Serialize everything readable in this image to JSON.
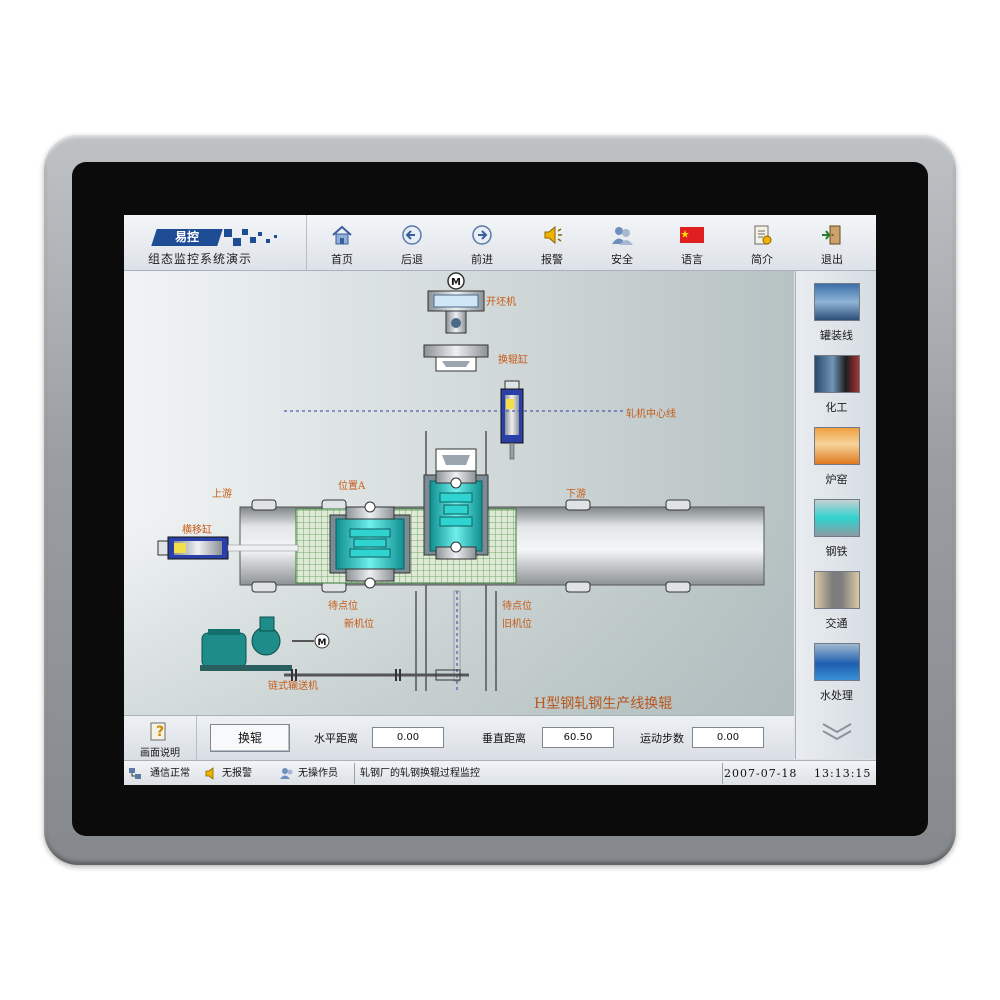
{
  "header": {
    "logo_text": "易控",
    "subtitle": "组态监控系统演示"
  },
  "nav": [
    {
      "label": "首页",
      "icon": "home-icon"
    },
    {
      "label": "后退",
      "icon": "back-arrow-icon"
    },
    {
      "label": "前进",
      "icon": "forward-arrow-icon"
    },
    {
      "label": "报警",
      "icon": "alarm-bell-icon"
    },
    {
      "label": "安全",
      "icon": "security-users-icon"
    },
    {
      "label": "语言",
      "icon": "china-flag-icon"
    },
    {
      "label": "简介",
      "icon": "introduction-document-icon"
    },
    {
      "label": "退出",
      "icon": "exit-door-icon"
    }
  ],
  "sidebar": [
    {
      "label": "罐装线",
      "icon": "filling-line-thumbnail"
    },
    {
      "label": "化工",
      "icon": "chemical-thumbnail"
    },
    {
      "label": "炉窑",
      "icon": "furnace-thumbnail"
    },
    {
      "label": "钢铁",
      "icon": "steel-thumbnail"
    },
    {
      "label": "交通",
      "icon": "traffic-thumbnail"
    },
    {
      "label": "水处理",
      "icon": "water-treatment-thumbnail"
    }
  ],
  "process": {
    "title": "H型钢轧钢生产线换辊",
    "labels": {
      "opener": "开坯机",
      "roll_cylinder": "换辊缸",
      "mill_center": "轧机中心线",
      "upstream": "上游",
      "downstream": "下游",
      "position_a": "位置A",
      "traverse_cylinder": "横移缸",
      "standby_left": "待点位",
      "stand_left": "新机位",
      "standby_right": "待点位",
      "stand_right": "旧机位",
      "chain_conveyor": "链式输送机",
      "motor": "M"
    }
  },
  "controls": {
    "help_label": "画面说明",
    "swap_button": "换辊",
    "horizontal_label": "水平距离",
    "horizontal_value": "0.00",
    "vertical_label": "垂直距离",
    "vertical_value": "60.50",
    "steps_label": "运动步数",
    "steps_value": "0.00"
  },
  "status": {
    "comm": "通信正常",
    "alarm": "无报警",
    "operator": "无操作员",
    "message": "轧钢厂的轧钢换辊过程监控",
    "date": "2007-07-18",
    "time": "13:13:15"
  },
  "colors": {
    "logo_blue": "#1f4d95",
    "label_orange": "#c85a16",
    "stand_cyan": "#2fd3cf",
    "cylinder_blue": "#2b3fa8"
  }
}
